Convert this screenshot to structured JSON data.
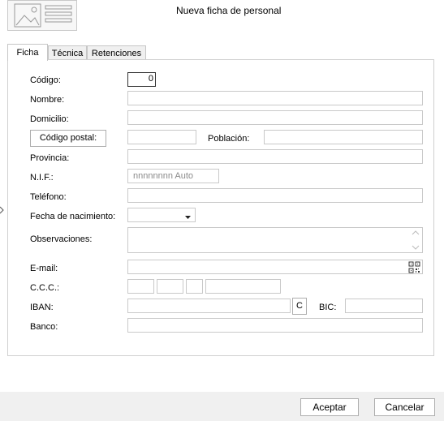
{
  "dialog": {
    "title": "Nueva ficha de personal",
    "header_icon": "form-card-icon"
  },
  "tabs": [
    {
      "label": "Ficha",
      "active": true
    },
    {
      "label": "Técnica",
      "active": false
    },
    {
      "label": "Retenciones",
      "active": false
    }
  ],
  "form": {
    "codigo": {
      "label": "Código:",
      "value": "0"
    },
    "nombre": {
      "label": "Nombre:",
      "value": ""
    },
    "domicilio": {
      "label": "Domicilio:",
      "value": ""
    },
    "codigo_postal": {
      "button_label": "Código postal:",
      "value": ""
    },
    "poblacion": {
      "label": "Población:",
      "value": ""
    },
    "provincia": {
      "label": "Provincia:",
      "value": ""
    },
    "nif": {
      "label": "N.I.F.:",
      "placeholder": "nnnnnnnn Auto"
    },
    "telefono": {
      "label": "Teléfono:",
      "value": ""
    },
    "fecha_nacimiento": {
      "label": "Fecha de nacimiento:",
      "value": ""
    },
    "observaciones": {
      "label": "Observaciones:",
      "value": ""
    },
    "email": {
      "label": "E-mail:",
      "value": "",
      "icon": "qr-code-icon"
    },
    "ccc": {
      "label": "C.C.C.:"
    },
    "iban": {
      "label": "IBAN:",
      "value": "",
      "button_label": "C"
    },
    "bic": {
      "label": "BIC:",
      "value": ""
    },
    "banco": {
      "label": "Banco:",
      "value": ""
    }
  },
  "footer": {
    "accept_label": "Aceptar",
    "cancel_label": "Cancelar"
  }
}
